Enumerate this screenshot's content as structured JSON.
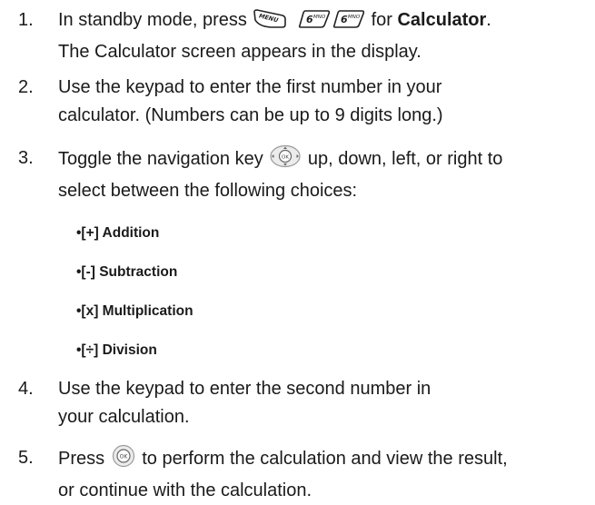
{
  "steps": [
    {
      "number": "1.",
      "line1_pre": "In standby mode, press",
      "keys": [
        {
          "name": "menu-key-icon",
          "label": "MENU"
        },
        {
          "name": "six-key-icon",
          "label": "6MNO"
        },
        {
          "name": "six-key-icon",
          "label": "6MNO"
        }
      ],
      "line1_post": "for",
      "line1_bold": "Calculator",
      "line1_end": ".",
      "line2": "The Calculator screen appears in the display."
    },
    {
      "number": "2.",
      "line1": "Use the keypad to enter the first number in your",
      "line2": "calculator. (Numbers can be up to 9 digits long.)"
    },
    {
      "number": "3.",
      "line1_pre": "Toggle the navigation key",
      "icon": "navigation-key-icon",
      "line1_post": "up, down, left, or right to",
      "line2": "select between the following choices:"
    },
    {
      "number": "4.",
      "line1": "Use the keypad to enter the second number in",
      "line2": "your calculation."
    },
    {
      "number": "5.",
      "line1_pre": "Press",
      "icon": "ok-key-icon",
      "line1_post": "to perform the calculation and view the result,",
      "line2": "or continue with the calculation."
    }
  ],
  "choices": [
    "•[+] Addition",
    "•[-] Subtraction",
    "•[x] Multiplication",
    "•[÷] Division"
  ]
}
